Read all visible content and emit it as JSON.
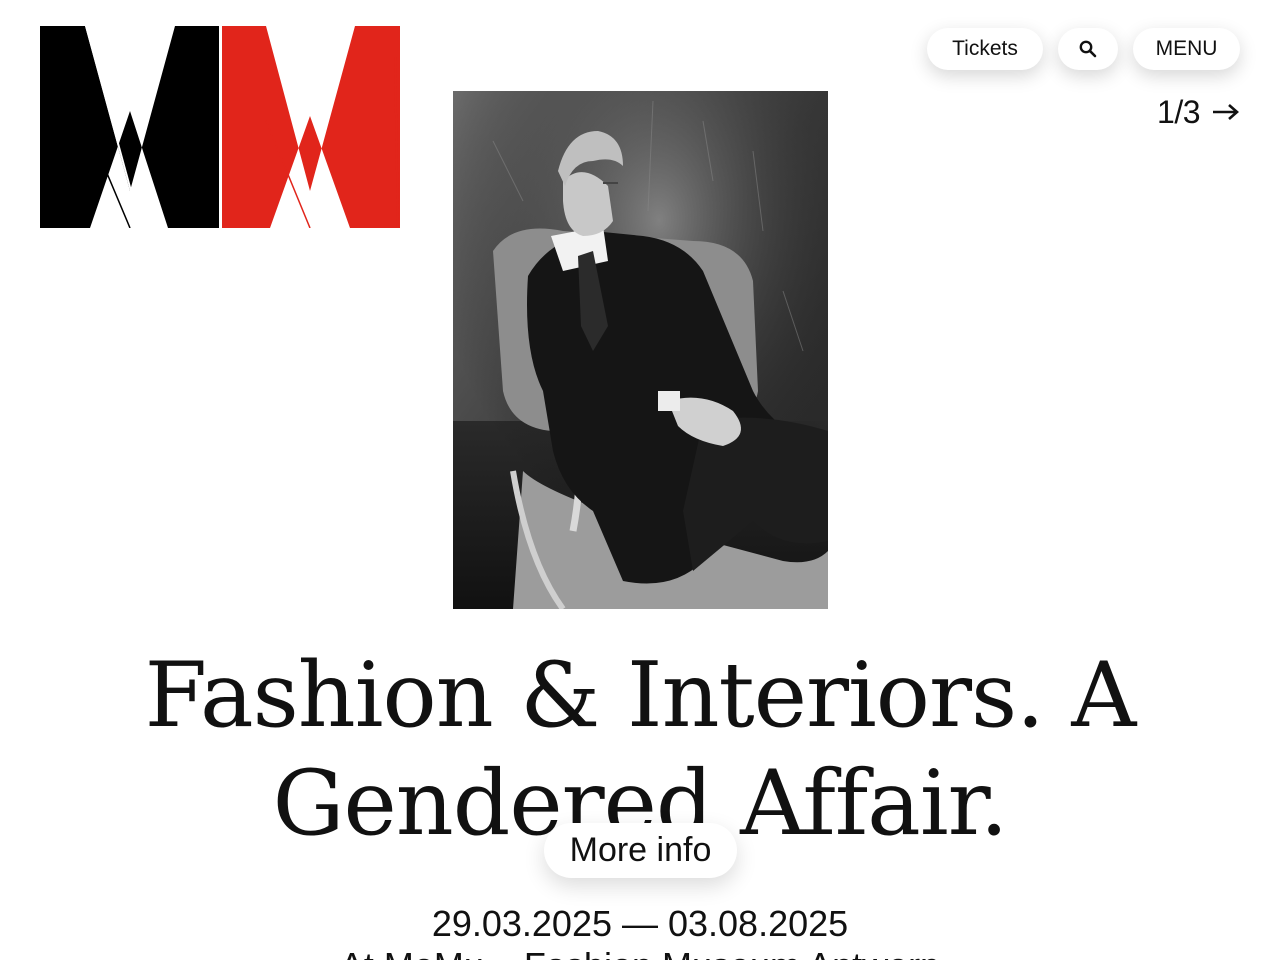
{
  "logo": {
    "name": "MoMu logo",
    "colors": {
      "left": "#000000",
      "right": "#e1251b"
    }
  },
  "header": {
    "tickets_label": "Tickets",
    "search_icon": "search-icon",
    "menu_label": "MENU"
  },
  "slider": {
    "counter": "1/3",
    "next_icon": "arrow-right-icon"
  },
  "exhibition": {
    "title": "Fashion & Interiors. A Gendered Affair.",
    "more_info_label": "More info",
    "dates": "29.03.2025 — 03.08.2025",
    "venue": "At MoMu – Fashion Museum Antwerp"
  },
  "colors": {
    "background": "#ffffff",
    "text": "#111111",
    "accent_red": "#e1251b"
  }
}
